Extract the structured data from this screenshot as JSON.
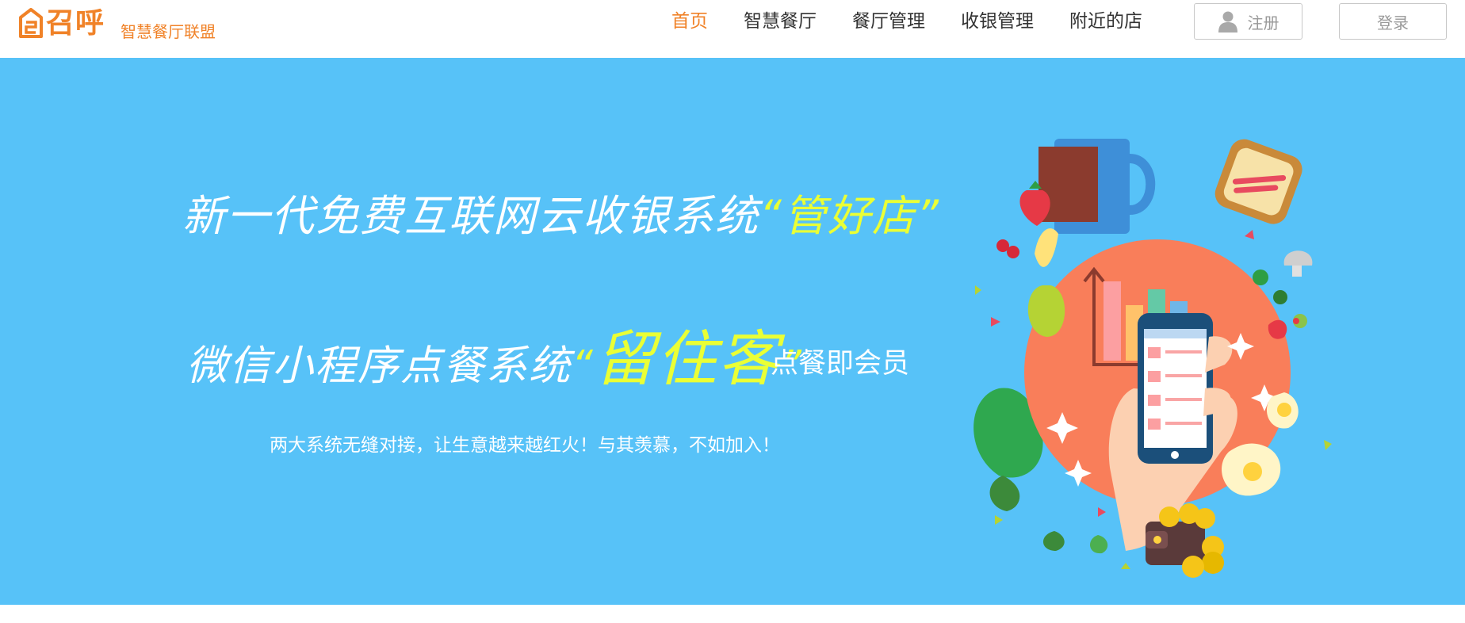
{
  "brand": {
    "name": "召呼",
    "subtitle": "智慧餐厅联盟",
    "color": "#f08228"
  },
  "nav": {
    "items": [
      {
        "label": "首页",
        "active": true
      },
      {
        "label": "智慧餐厅",
        "active": false
      },
      {
        "label": "餐厅管理",
        "active": false
      },
      {
        "label": "收银管理",
        "active": false
      },
      {
        "label": "附近的店",
        "active": false
      }
    ]
  },
  "auth": {
    "register_label": "注册",
    "login_label": "登录",
    "register_icon": "user-icon"
  },
  "hero": {
    "background": "#57c2f8",
    "highlight_color": "#eaff35",
    "line1_text": "新一代免费互联网云收银系统",
    "line1_quote_open": "“",
    "line1_highlight": "管好店",
    "line1_quote_close": "”",
    "line2_text": "微信小程序点餐系统",
    "line2_quote_open": "“",
    "line2_highlight": "留住客",
    "line2_quote_close": "”",
    "line2_suffix": "点餐即会员",
    "tagline": "两大系统无缝对接，让生意越来越红火！与其羡慕，不如加入！",
    "illustration": "phone-ordering-illustration"
  }
}
